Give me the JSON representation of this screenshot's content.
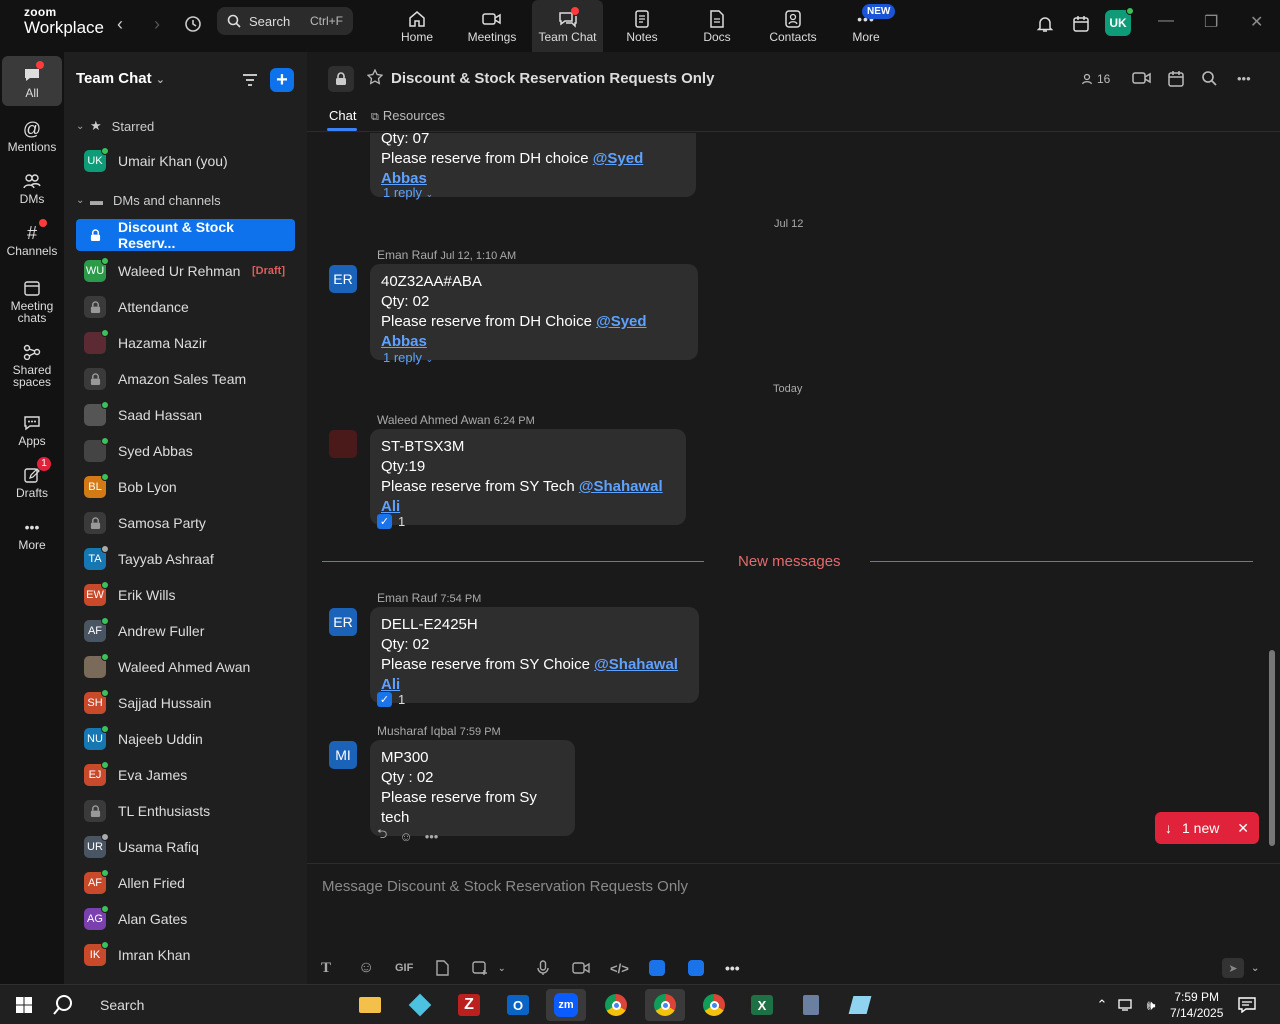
{
  "app": {
    "brand_top": "zoom",
    "brand_bottom": "Workplace",
    "search_label": "Search",
    "search_shortcut": "Ctrl+F"
  },
  "top_tabs": [
    {
      "label": "Home",
      "icon": "home-icon"
    },
    {
      "label": "Meetings",
      "icon": "video-icon"
    },
    {
      "label": "Team Chat",
      "icon": "chat-icon"
    },
    {
      "label": "Notes",
      "icon": "notes-icon"
    },
    {
      "label": "Docs",
      "icon": "docs-icon"
    },
    {
      "label": "Contacts",
      "icon": "contacts-icon"
    },
    {
      "label": "More",
      "icon": "more-icon"
    }
  ],
  "new_badge": "NEW",
  "user_initials": "UK",
  "rail": [
    {
      "label": "All"
    },
    {
      "label": "Mentions"
    },
    {
      "label": "DMs"
    },
    {
      "label": "Channels"
    },
    {
      "label": "Meeting chats"
    },
    {
      "label": "Shared spaces"
    },
    {
      "label": "Apps"
    },
    {
      "label": "Drafts",
      "badge": "1"
    },
    {
      "label": "More"
    }
  ],
  "sidebar": {
    "title": "Team Chat",
    "starred_label": "Starred",
    "dms_label": "DMs and channels",
    "starred_items": [
      {
        "name": "Umair Khan (you)",
        "initials": "UK",
        "color": "#0e9b77"
      }
    ],
    "items": [
      {
        "name": "Discount & Stock Reserv...",
        "type": "lock"
      },
      {
        "name": "Waleed Ur Rehman",
        "initials": "WU",
        "color": "#2c9a49",
        "draft": "[Draft]"
      },
      {
        "name": "Attendance",
        "type": "lock"
      },
      {
        "name": "Hazama Nazir",
        "initials": "",
        "color": "#5b2a33"
      },
      {
        "name": "Amazon Sales Team",
        "type": "lock"
      },
      {
        "name": "Saad Hassan",
        "initials": "",
        "color": "#555"
      },
      {
        "name": "Syed Abbas",
        "initials": "",
        "color": "#444"
      },
      {
        "name": "Bob Lyon",
        "initials": "BL",
        "color": "#d27a16"
      },
      {
        "name": "Samosa Party",
        "type": "lock"
      },
      {
        "name": "Tayyab Ashraaf",
        "initials": "TA",
        "color": "#1677b3"
      },
      {
        "name": "Erik Wills",
        "initials": "EW",
        "color": "#c94a2b"
      },
      {
        "name": "Andrew Fuller",
        "initials": "AF",
        "color": "#4a5563"
      },
      {
        "name": "Waleed Ahmed Awan",
        "initials": "",
        "color": "#7a6a5a"
      },
      {
        "name": "Sajjad Hussain",
        "initials": "SH",
        "color": "#c94a2b"
      },
      {
        "name": "Najeeb Uddin",
        "initials": "NU",
        "color": "#1677b3"
      },
      {
        "name": "Eva James",
        "initials": "EJ",
        "color": "#c94a2b"
      },
      {
        "name": "TL Enthusiasts",
        "type": "lock"
      },
      {
        "name": "Usama Rafiq",
        "initials": "UR",
        "color": "#4a5563"
      },
      {
        "name": "Allen Fried",
        "initials": "AF",
        "color": "#c94a2b"
      },
      {
        "name": "Alan Gates",
        "initials": "AG",
        "color": "#7b3fb0"
      },
      {
        "name": "Imran Khan",
        "initials": "IK",
        "color": "#c94a2b"
      }
    ]
  },
  "channel": {
    "title": "Discount & Stock Reservation Requests Only",
    "members": "16",
    "tabs": [
      "Chat",
      "Resources"
    ]
  },
  "messages": {
    "m0": {
      "line1": "Qty: 07",
      "line2": "Please reserve from DH choice ",
      "mention": "@Syed Abbas",
      "reply": "1 reply"
    },
    "sep1": "Jul 12",
    "m1": {
      "sender": "Eman Rauf",
      "time": "Jul 12, 1:10 AM",
      "initials": "ER",
      "line1": "40Z32AA#ABA",
      "line2": "Qty: 02",
      "line3": "Please reserve from DH Choice ",
      "mention": "@Syed Abbas",
      "reply": "1 reply"
    },
    "sep2": "Today",
    "m2": {
      "sender": "Waleed Ahmed Awan",
      "time": "6:24 PM",
      "line1": "ST-BTSX3M",
      "line2": "Qty:19",
      "line3": "Please reserve from SY Tech ",
      "mention": "@Shahawal Ali",
      "react": "1"
    },
    "new_messages": "New messages",
    "m3": {
      "sender": "Eman Rauf",
      "time": "7:54 PM",
      "initials": "ER",
      "line1": "DELL-E2425H",
      "line2": "Qty: 02",
      "line3": "Please reserve from SY Choice ",
      "mention": "@Shahawal Ali",
      "react": "1"
    },
    "m4": {
      "sender": "Musharaf Iqbal",
      "time": "7:59 PM",
      "initials": "MI",
      "line1": "MP300",
      "line2": "Qty : 02",
      "line3": "Please reserve from Sy tech"
    },
    "new_pill": "1 new"
  },
  "composer": {
    "placeholder": "Message Discount & Stock Reservation Requests Only",
    "gif": "GIF"
  },
  "taskbar": {
    "search": "Search",
    "time": "7:59 PM",
    "date": "7/14/2025"
  }
}
